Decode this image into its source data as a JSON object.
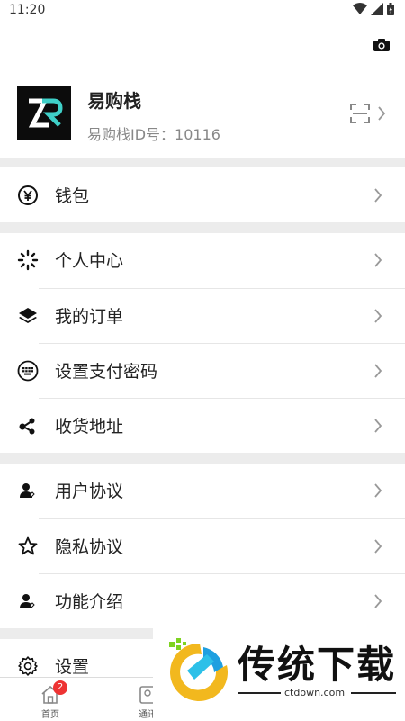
{
  "status_bar": {
    "time": "11:20"
  },
  "profile": {
    "name": "易购栈",
    "id_text": "易购栈ID号：10116"
  },
  "menu": {
    "wallet": "钱包",
    "personal_center": "个人中心",
    "my_orders": "我的订单",
    "set_pay_password": "设置支付密码",
    "address": "收货地址",
    "user_agreement": "用户协议",
    "privacy_agreement": "隐私协议",
    "features": "功能介绍",
    "settings": "设置"
  },
  "bottom_nav": {
    "home_label": "首页",
    "home_badge": "2",
    "contacts_label": "通讯"
  },
  "watermark": {
    "text": "传统下载",
    "url": "ctdown.com"
  },
  "colors": {
    "accent_logo": "#3fd0c8",
    "badge": "#ee3333",
    "gap": "#ececec"
  }
}
